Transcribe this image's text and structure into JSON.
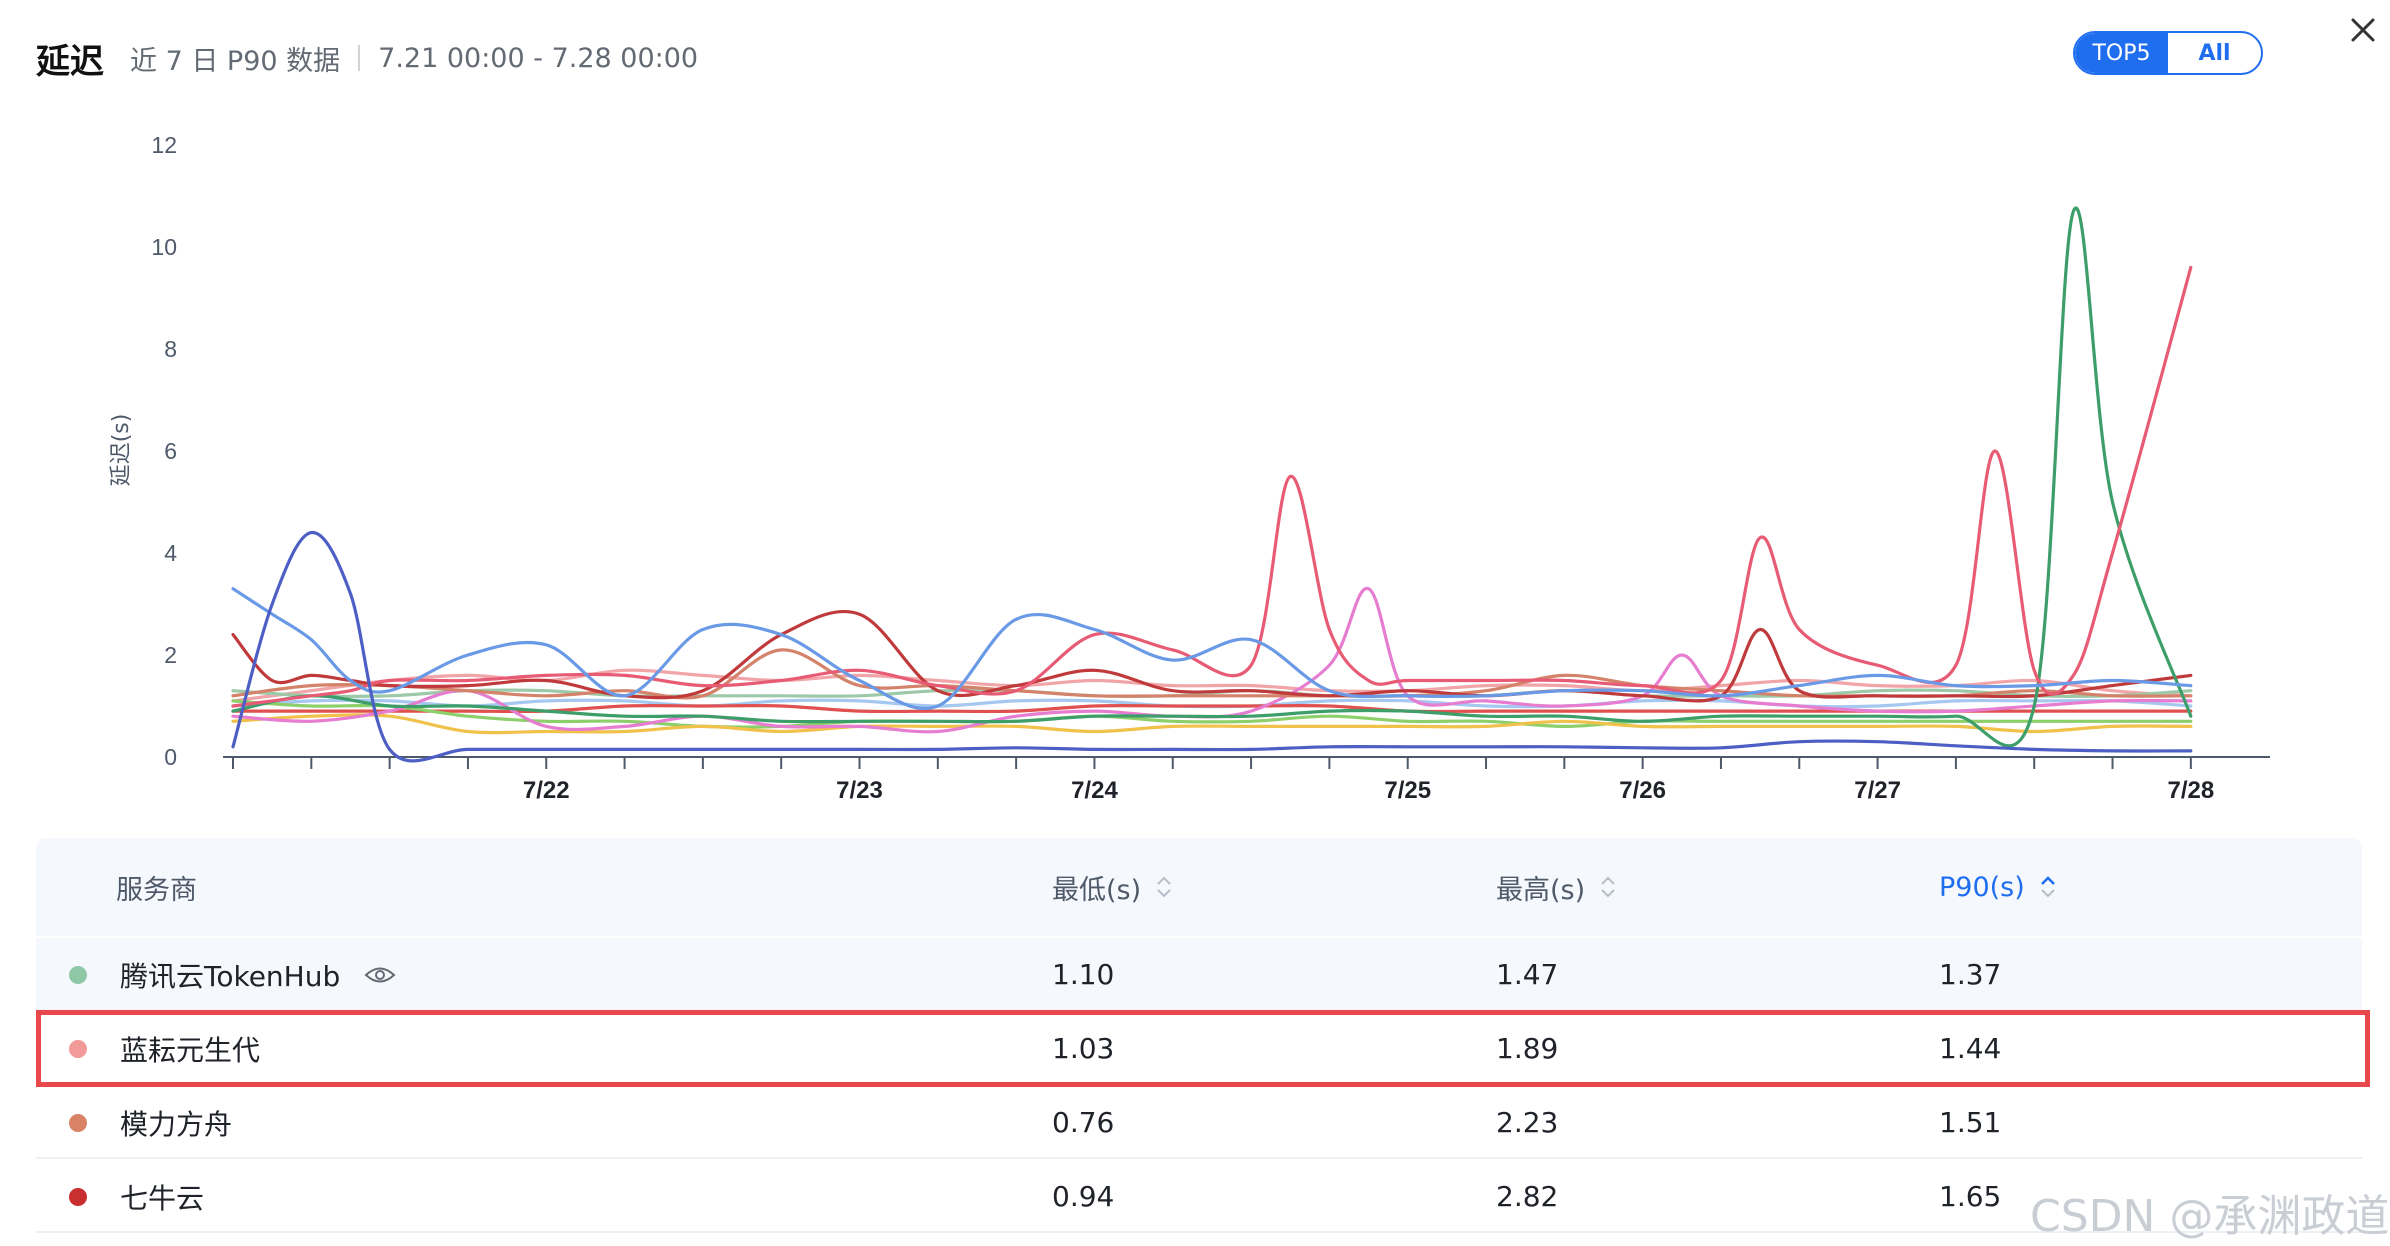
{
  "header": {
    "title": "延迟",
    "subtitle": "近 7 日 P90 数据",
    "range": "7.21 00:00 - 7.28 00:00"
  },
  "toggle": {
    "top5": "TOP5",
    "all": "All",
    "selected": "All"
  },
  "icons": {
    "close": "close-icon",
    "eye": "eye-icon",
    "sort": "sort-icon"
  },
  "chart_data": {
    "type": "line",
    "ylabel": "延迟(s)",
    "xlabel": "",
    "ylim": [
      0,
      12
    ],
    "yticks": [
      "0",
      "2",
      "4",
      "6",
      "8",
      "10",
      "12"
    ],
    "xlim": [
      0,
      25.5
    ],
    "xtick_labels": [
      {
        "x": 4,
        "label": "7/22"
      },
      {
        "x": 8,
        "label": "7/23"
      },
      {
        "x": 11,
        "label": "7/24"
      },
      {
        "x": 15,
        "label": "7/25"
      },
      {
        "x": 18,
        "label": "7/26"
      },
      {
        "x": 21,
        "label": "7/27"
      },
      {
        "x": 25,
        "label": "7/28"
      }
    ],
    "minor_tick_count": 26,
    "grid": false,
    "legend": "none",
    "series": [
      {
        "color": "#4d5fc4",
        "x": [
          0,
          0.5,
          1,
          1.5,
          2,
          3,
          4,
          5,
          6,
          7,
          8,
          9,
          10,
          11,
          12,
          13,
          14,
          15,
          16,
          17,
          18,
          19,
          20,
          21,
          22,
          23,
          24,
          25
        ],
        "values": [
          0.2,
          3.0,
          4.4,
          3.2,
          0.15,
          0.15,
          0.15,
          0.15,
          0.15,
          0.15,
          0.15,
          0.15,
          0.18,
          0.15,
          0.15,
          0.15,
          0.2,
          0.2,
          0.2,
          0.2,
          0.18,
          0.18,
          0.3,
          0.3,
          0.22,
          0.15,
          0.12,
          0.12
        ]
      },
      {
        "color": "#6a9ae6",
        "x": [
          0,
          0.5,
          1,
          1.5,
          2,
          3,
          4,
          5,
          6,
          7,
          8,
          9,
          10,
          11,
          12,
          13,
          14,
          15,
          16,
          17,
          18,
          19,
          20,
          21,
          22,
          23,
          24,
          25
        ],
        "values": [
          3.3,
          2.8,
          2.3,
          1.5,
          1.3,
          2.0,
          2.2,
          1.2,
          2.5,
          2.4,
          1.5,
          1.0,
          2.7,
          2.5,
          1.9,
          2.3,
          1.3,
          1.2,
          1.2,
          1.3,
          1.3,
          1.2,
          1.4,
          1.6,
          1.4,
          1.4,
          1.5,
          1.4
        ]
      },
      {
        "color": "#e85b74",
        "x": [
          0,
          0.5,
          1,
          1.5,
          2,
          3,
          4,
          5,
          6,
          7,
          8,
          9,
          10,
          11,
          12,
          13,
          13.5,
          14,
          14.5,
          15,
          16,
          17,
          18,
          19,
          19.5,
          20,
          21,
          22,
          22.5,
          23,
          23.5,
          24,
          25
        ],
        "values": [
          1.0,
          1.1,
          1.2,
          1.3,
          1.5,
          1.5,
          1.6,
          1.6,
          1.4,
          1.5,
          1.7,
          1.4,
          1.3,
          2.4,
          2.1,
          1.8,
          5.5,
          2.5,
          1.5,
          1.5,
          1.5,
          1.5,
          1.4,
          1.5,
          4.3,
          2.5,
          1.8,
          1.8,
          6.0,
          1.7,
          1.6,
          4.0,
          9.6
        ]
      },
      {
        "color": "#3d9e6a",
        "x": [
          0,
          1,
          2,
          3,
          4,
          5,
          6,
          7,
          8,
          9,
          10,
          11,
          12,
          13,
          14,
          15,
          16,
          17,
          18,
          19,
          20,
          21,
          22,
          23,
          23.5,
          24,
          25
        ],
        "values": [
          0.9,
          1.2,
          1.0,
          1.0,
          0.9,
          0.8,
          0.8,
          0.7,
          0.7,
          0.7,
          0.7,
          0.8,
          0.8,
          0.8,
          0.9,
          0.9,
          0.8,
          0.8,
          0.7,
          0.8,
          0.8,
          0.8,
          0.8,
          1.0,
          10.7,
          5.0,
          0.8
        ]
      },
      {
        "color": "#c0393b",
        "x": [
          0,
          0.5,
          1,
          1.5,
          2,
          3,
          4,
          5,
          6,
          7,
          8,
          9,
          10,
          11,
          12,
          13,
          14,
          15,
          16,
          17,
          18,
          19,
          19.5,
          20,
          21,
          22,
          23,
          24,
          25
        ],
        "values": [
          2.4,
          1.5,
          1.6,
          1.5,
          1.4,
          1.4,
          1.5,
          1.2,
          1.3,
          2.4,
          2.8,
          1.3,
          1.4,
          1.7,
          1.3,
          1.3,
          1.2,
          1.3,
          1.2,
          1.3,
          1.2,
          1.2,
          2.5,
          1.3,
          1.2,
          1.2,
          1.2,
          1.4,
          1.6
        ]
      },
      {
        "color": "#d4826a",
        "x": [
          0,
          1,
          2,
          3,
          4,
          5,
          6,
          7,
          8,
          9,
          10,
          11,
          12,
          13,
          14,
          15,
          16,
          17,
          18,
          19,
          20,
          21,
          22,
          23,
          24,
          25
        ],
        "values": [
          1.2,
          1.4,
          1.4,
          1.3,
          1.2,
          1.3,
          1.2,
          2.1,
          1.4,
          1.4,
          1.3,
          1.2,
          1.2,
          1.2,
          1.2,
          1.2,
          1.3,
          1.6,
          1.4,
          1.3,
          1.2,
          1.2,
          1.2,
          1.3,
          1.2,
          1.2
        ]
      },
      {
        "color": "#e67dd0",
        "x": [
          0,
          1,
          2,
          3,
          4,
          5,
          6,
          7,
          8,
          9,
          10,
          11,
          12,
          13,
          14,
          14.5,
          15,
          16,
          17,
          18,
          18.5,
          19,
          20,
          21,
          22,
          23,
          24,
          25
        ],
        "values": [
          0.8,
          0.7,
          0.9,
          1.3,
          0.6,
          0.6,
          0.8,
          0.6,
          0.6,
          0.5,
          0.8,
          0.9,
          0.8,
          0.9,
          1.8,
          3.3,
          1.2,
          1.1,
          1.0,
          1.2,
          2.0,
          1.2,
          1.0,
          0.9,
          0.9,
          1.0,
          1.1,
          1.1
        ]
      },
      {
        "color": "#f0c14b",
        "x": [
          0,
          1,
          2,
          3,
          4,
          5,
          6,
          7,
          8,
          9,
          10,
          11,
          12,
          13,
          14,
          15,
          16,
          17,
          18,
          19,
          20,
          21,
          22,
          23,
          24,
          25
        ],
        "values": [
          0.7,
          0.8,
          0.8,
          0.5,
          0.5,
          0.5,
          0.6,
          0.5,
          0.6,
          0.6,
          0.6,
          0.5,
          0.6,
          0.6,
          0.6,
          0.6,
          0.6,
          0.7,
          0.6,
          0.6,
          0.6,
          0.6,
          0.6,
          0.5,
          0.6,
          0.6
        ]
      },
      {
        "color": "#8ccf6b",
        "x": [
          0,
          1,
          2,
          3,
          4,
          5,
          6,
          7,
          8,
          9,
          10,
          11,
          12,
          13,
          14,
          15,
          16,
          17,
          18,
          19,
          20,
          21,
          22,
          23,
          24,
          25
        ],
        "values": [
          1.1,
          1.0,
          1.0,
          0.8,
          0.7,
          0.7,
          0.6,
          0.6,
          0.7,
          0.7,
          0.7,
          0.8,
          0.7,
          0.7,
          0.8,
          0.7,
          0.7,
          0.6,
          0.7,
          0.7,
          0.7,
          0.7,
          0.7,
          0.7,
          0.7,
          0.7
        ]
      },
      {
        "color": "#9ec9a8",
        "x": [
          0,
          1,
          2,
          3,
          4,
          5,
          6,
          7,
          8,
          9,
          10,
          11,
          12,
          13,
          14,
          15,
          16,
          17,
          18,
          19,
          20,
          21,
          22,
          23,
          24,
          25
        ],
        "values": [
          1.3,
          1.2,
          1.2,
          1.3,
          1.3,
          1.2,
          1.2,
          1.2,
          1.2,
          1.3,
          1.3,
          1.2,
          1.2,
          1.3,
          1.2,
          1.2,
          1.2,
          1.3,
          1.2,
          1.2,
          1.2,
          1.3,
          1.3,
          1.2,
          1.2,
          1.3
        ]
      },
      {
        "color": "#f2a5a8",
        "x": [
          0,
          1,
          2,
          3,
          4,
          5,
          6,
          7,
          8,
          9,
          10,
          11,
          12,
          13,
          14,
          15,
          16,
          17,
          18,
          19,
          20,
          21,
          22,
          23,
          24,
          25
        ],
        "values": [
          1.1,
          1.3,
          1.5,
          1.6,
          1.5,
          1.7,
          1.6,
          1.5,
          1.6,
          1.5,
          1.4,
          1.5,
          1.4,
          1.4,
          1.3,
          1.3,
          1.4,
          1.4,
          1.3,
          1.4,
          1.5,
          1.4,
          1.4,
          1.5,
          1.3,
          1.2
        ]
      },
      {
        "color": "#e0504f",
        "x": [
          0,
          1,
          2,
          3,
          4,
          5,
          6,
          7,
          8,
          9,
          10,
          11,
          12,
          13,
          14,
          15,
          16,
          17,
          18,
          19,
          20,
          21,
          22,
          23,
          24,
          25
        ],
        "values": [
          0.9,
          0.9,
          0.9,
          0.9,
          0.9,
          1.0,
          1.0,
          1.0,
          0.9,
          0.9,
          0.9,
          1.0,
          1.0,
          1.0,
          1.0,
          0.9,
          0.9,
          0.9,
          0.9,
          0.9,
          0.9,
          0.9,
          0.9,
          0.9,
          0.9,
          0.9
        ]
      },
      {
        "color": "#a6c8f0",
        "x": [
          0,
          1,
          2,
          3,
          4,
          5,
          6,
          7,
          8,
          9,
          10,
          11,
          12,
          13,
          14,
          15,
          16,
          17,
          18,
          19,
          20,
          21,
          22,
          23,
          24,
          25
        ],
        "values": [
          1.0,
          1.1,
          1.1,
          1.0,
          1.1,
          1.1,
          1.0,
          1.1,
          1.1,
          1.0,
          1.1,
          1.1,
          1.0,
          1.0,
          1.1,
          1.1,
          1.0,
          1.0,
          1.1,
          1.1,
          1.0,
          1.0,
          1.1,
          1.1,
          1.1,
          1.0
        ]
      }
    ]
  },
  "table": {
    "headers": {
      "provider": "服务商",
      "min": "最低(s)",
      "max": "最高(s)",
      "p90": "P90(s)"
    },
    "rows": [
      {
        "name": "腾讯云TokenHub",
        "color": "#8fc8a6",
        "min": "1.10",
        "max": "1.47",
        "p90": "1.37",
        "has_eye": true
      },
      {
        "name": "蓝耘元生代",
        "color": "#f2999a",
        "min": "1.03",
        "max": "1.89",
        "p90": "1.44",
        "highlighted": true
      },
      {
        "name": "模力方舟",
        "color": "#d98366",
        "min": "0.76",
        "max": "2.23",
        "p90": "1.51"
      },
      {
        "name": "七牛云",
        "color": "#c92f2f",
        "min": "0.94",
        "max": "2.82",
        "p90": "1.65"
      }
    ]
  },
  "watermark": "CSDN @承渊政道"
}
